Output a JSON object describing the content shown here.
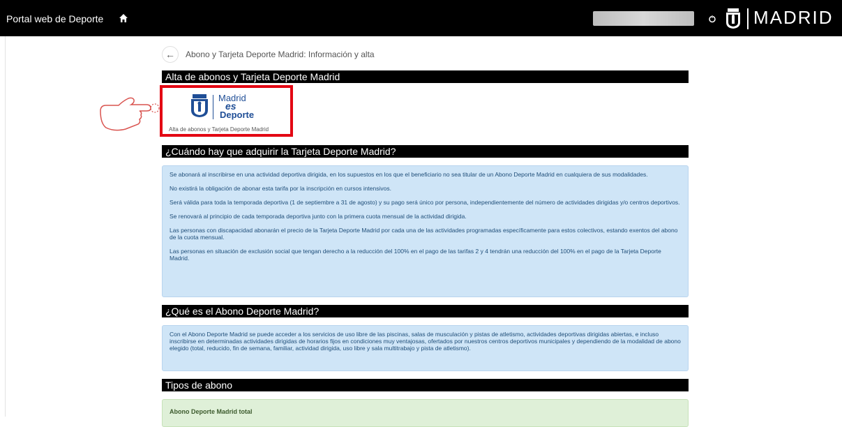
{
  "header": {
    "title": "Portal web de Deporte",
    "logo_text": "MADRID"
  },
  "breadcrumb": {
    "text": "Abono y Tarjeta Deporte Madrid: Información y alta"
  },
  "sections": {
    "alta": "Alta de abonos y Tarjeta Deporte Madrid",
    "cuando": "¿Cuándo hay que adquirir la Tarjeta Deporte Madrid?",
    "que_es": "¿Qué es el Abono Deporte Madrid?",
    "tipos": "Tipos de abono"
  },
  "logo_card": {
    "brand_line1": "Madrid",
    "brand_line2": "es",
    "brand_line3": "Deporte",
    "caption": "Alta de abonos y Tarjeta Deporte Madrid"
  },
  "tarjeta_info": [
    "Se abonará al inscribirse en una actividad deportiva dirigida, en los supuestos en los que el beneficiario no sea titular de un Abono Deporte Madrid en cualquiera de sus modalidades.",
    "No existirá la obligación de abonar esta tarifa por la inscripción en cursos intensivos.",
    "Será válida para toda la temporada deportiva (1 de septiembre a 31 de agosto) y su pago será único por persona, independientemente del número de actividades dirigidas y/o centros deportivos.",
    "Se renovará al principio de cada temporada deportiva junto con la primera cuota mensual de la actividad dirigida.",
    "Las personas con discapacidad abonarán el precio de la Tarjeta Deporte Madrid por cada una de las actividades programadas específicamente para estos colectivos, estando exentos del abono de la cuota mensual.",
    "Las personas en situación de exclusión social que tengan derecho a la reducción del 100% en el pago de las tarifas 2 y 4 tendrán una reducción del 100% en el pago de la Tarjeta Deporte Madrid."
  ],
  "abono_info": "Con el Abono Deporte Madrid se puede acceder a los servicios de uso libre de las piscinas, salas de musculación y pistas de atletismo, actividades deportivas dirigidas abiertas, e incluso inscribirse en determinadas actividades dirigidas de horarios fijos en condiciones muy ventajosas, ofertados por nuestros centros deportivos municipales y dependiendo de la modalidad de abono elegido (total, reducido, fin de semana, familiar, actividad dirigida, uso libre y sala multitrabajo y pista de atletismo).",
  "tipos": {
    "first_item": "Abono Deporte Madrid total"
  },
  "icons": {
    "home": "home-icon",
    "power": "power-icon",
    "back": "back-arrow-icon",
    "shield": "madrid-shield-icon",
    "hand": "pointing-hand-icon"
  },
  "colors": {
    "header_bg": "#000000",
    "section_bg": "#000000",
    "info_bg": "#cfe5f7",
    "info_text": "#1f4e79",
    "highlight_border": "#e30613",
    "green_bg": "#dff0d8",
    "brand_blue": "#1f4e96"
  }
}
